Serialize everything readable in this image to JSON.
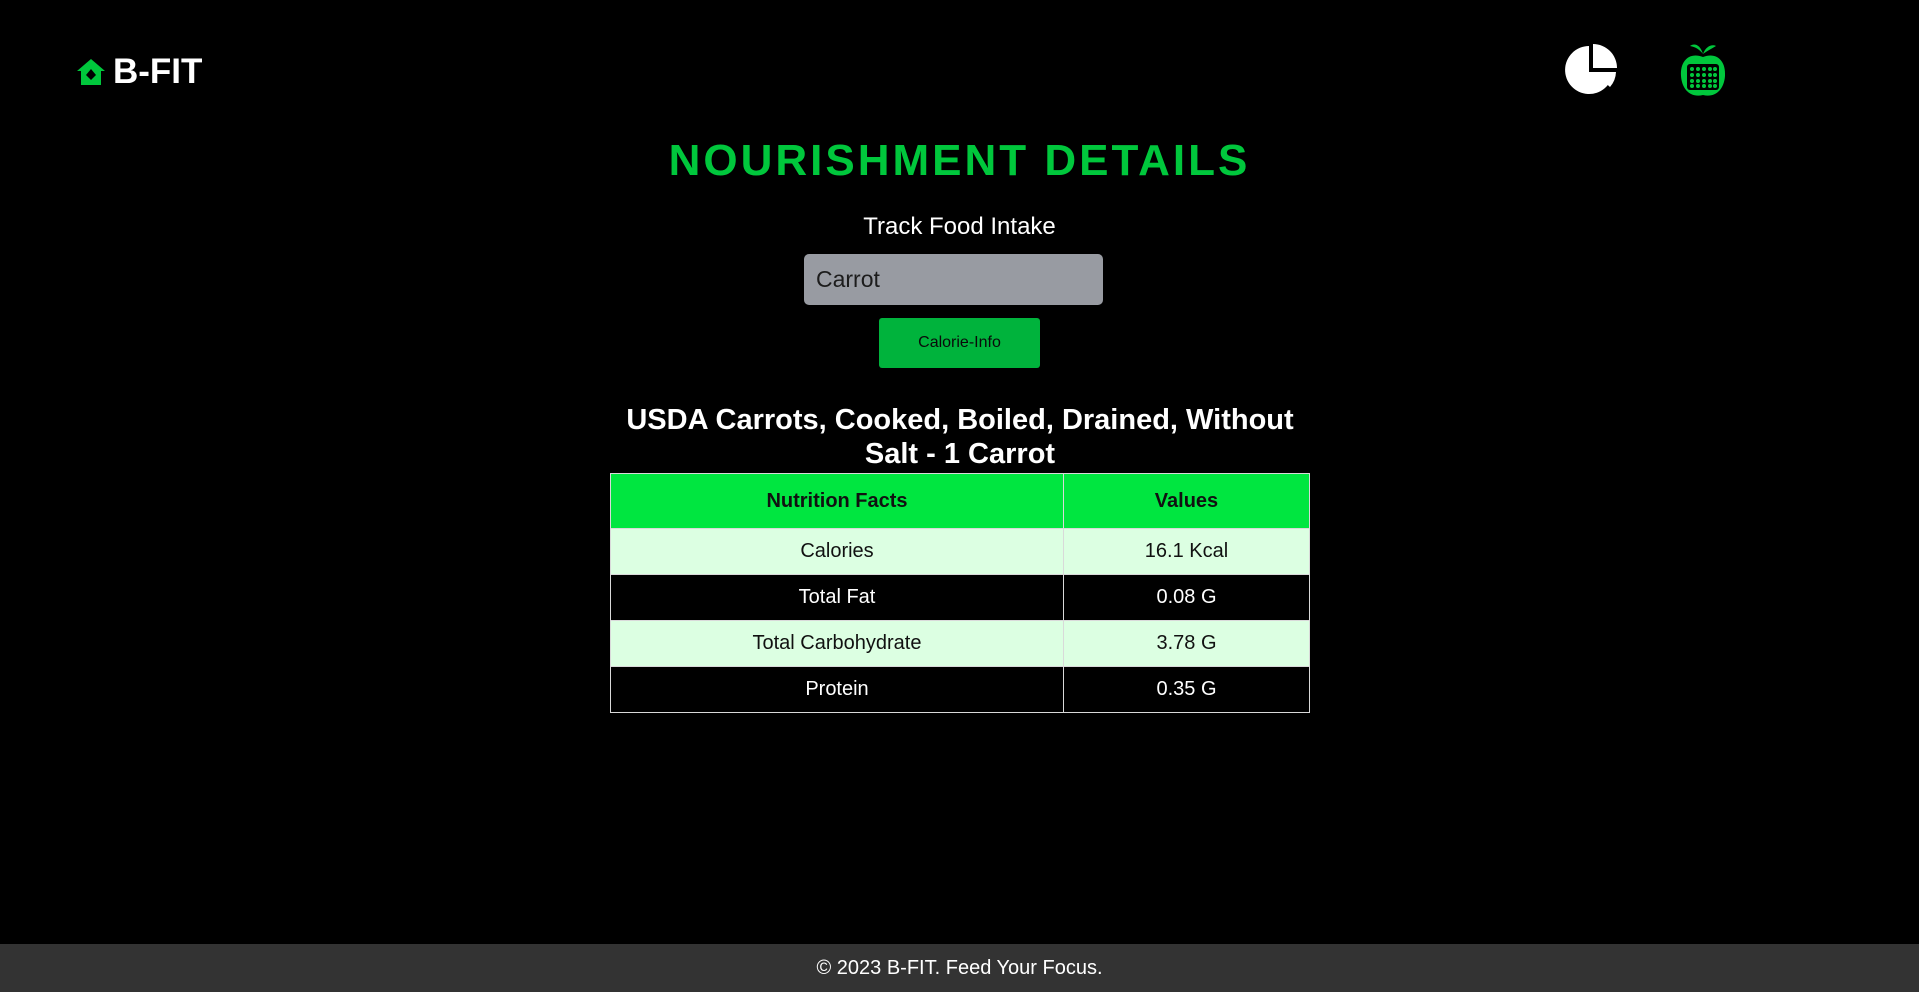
{
  "header": {
    "brand_name": "B-FIT",
    "brand_icon": "home-icon",
    "nav_icons": [
      "pie-chart-icon",
      "apple-calculator-icon"
    ]
  },
  "main": {
    "title": "NOURISHMENT DETAILS",
    "track_label": "Track Food Intake",
    "food_input_value": "Carrot",
    "calorie_button_label": "Calorie-Info",
    "food_heading": "USDA Carrots, Cooked, Boiled, Drained, Without Salt - 1 Carrot",
    "table": {
      "headers": [
        "Nutrition Facts",
        "Values"
      ],
      "rows": [
        {
          "fact": "Calories",
          "value": "16.1 Kcal"
        },
        {
          "fact": "Total Fat",
          "value": "0.08 G"
        },
        {
          "fact": "Total Carbohydrate",
          "value": "3.78 G"
        },
        {
          "fact": "Protein",
          "value": "0.35 G"
        }
      ]
    }
  },
  "footer": {
    "text": "© 2023 B-FIT. Feed Your Focus."
  },
  "colors": {
    "accent": "#00c73c",
    "table_header": "#00e640",
    "row_light": "#dcffe2",
    "input_bg": "#989ba2",
    "footer_bg": "#333333"
  }
}
